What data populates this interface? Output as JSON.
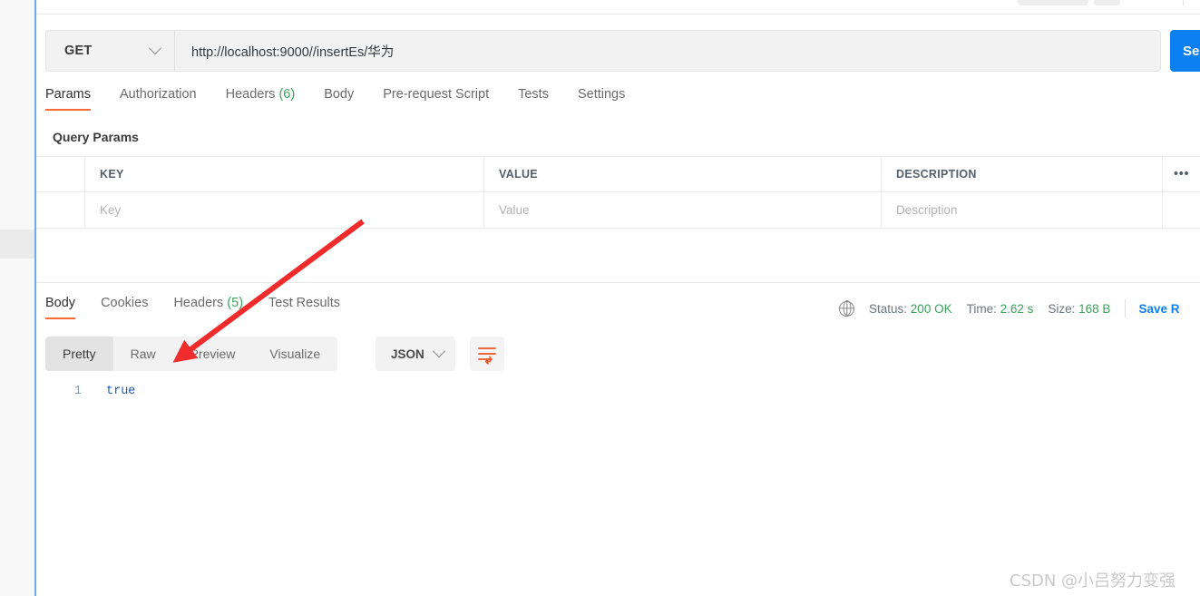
{
  "sidebar": {
    "name": "collections-rail"
  },
  "request": {
    "method": "GET",
    "url": "http://localhost:9000//insertEs/华为",
    "send_label": "Send",
    "tabs": [
      {
        "label": "Params",
        "active": true
      },
      {
        "label": "Authorization",
        "active": false
      },
      {
        "label": "Headers",
        "count": "(6)",
        "active": false
      },
      {
        "label": "Body",
        "active": false
      },
      {
        "label": "Pre-request Script",
        "active": false
      },
      {
        "label": "Tests",
        "active": false
      },
      {
        "label": "Settings",
        "active": false
      }
    ]
  },
  "query_params": {
    "section_title": "Query Params",
    "columns": [
      "KEY",
      "VALUE",
      "DESCRIPTION"
    ],
    "bulk_menu_icon": "•••",
    "empty_row": {
      "key_placeholder": "Key",
      "value_placeholder": "Value",
      "description_placeholder": "Description"
    }
  },
  "response": {
    "tabs": [
      {
        "label": "Body",
        "active": true
      },
      {
        "label": "Cookies",
        "active": false
      },
      {
        "label": "Headers",
        "count": "(5)",
        "active": false
      },
      {
        "label": "Test Results",
        "active": false
      }
    ],
    "meta": {
      "globe_icon": "globe-icon",
      "status_label": "Status:",
      "status_value": "200 OK",
      "time_label": "Time:",
      "time_value": "2.62 s",
      "size_label": "Size:",
      "size_value": "168 B",
      "save_response_label": "Save R"
    },
    "view_modes": [
      {
        "label": "Pretty",
        "active": true
      },
      {
        "label": "Raw",
        "active": false
      },
      {
        "label": "Preview",
        "active": false
      },
      {
        "label": "Visualize",
        "active": false
      }
    ],
    "format": "JSON",
    "wrap_icon": "word-wrap-icon",
    "code": [
      {
        "line": "1",
        "text": "true"
      }
    ]
  },
  "annotation": {
    "type": "red-arrow"
  },
  "watermark": {
    "text": "CSDN @小吕努力变强"
  },
  "colors": {
    "accent_orange": "#ff6c37",
    "send_blue": "#0c7ff2",
    "status_green": "#3aa45b",
    "arrow_red": "#f02b2b",
    "divider_blue": "#6aabe8"
  }
}
